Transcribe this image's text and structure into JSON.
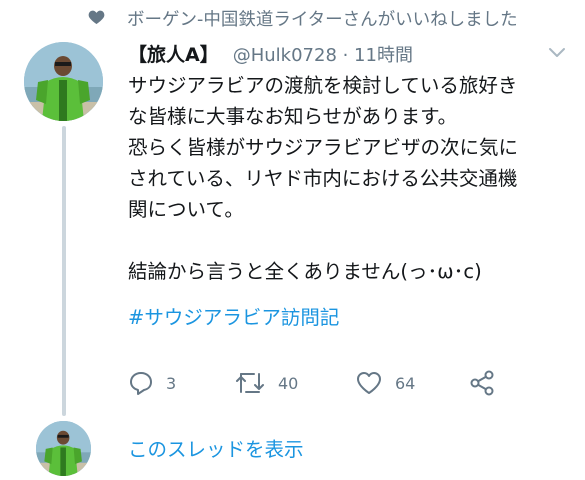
{
  "context": {
    "icon": "heart-icon",
    "text": "ボーゲン-中国鉄道ライターさんがいいねしました"
  },
  "tweet": {
    "display_name": "【旅人A】",
    "handle_time": "@Hulk0728 · 11時間",
    "body_lines": [
      "サウジアラビアの渡航を検討している旅好き",
      "な皆様に大事なお知らせがあります。",
      "恐らく皆様がサウジアラビアビザの次に気に",
      "されている、リヤド市内における公共交通機",
      "関について。",
      "",
      "結論から言うと全くありません(っ･ω･c)"
    ],
    "hashtag": "#サウジアラビア訪問記",
    "actions": {
      "reply_count": "3",
      "retweet_count": "40",
      "like_count": "64"
    }
  },
  "show_thread": "このスレッドを表示",
  "colors": {
    "text": "#14171a",
    "secondary": "#657786",
    "link": "#1b95e0",
    "thread_line": "#ccd6dd"
  }
}
